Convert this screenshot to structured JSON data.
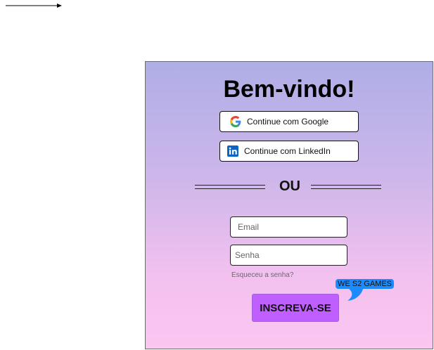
{
  "login": {
    "title": "Bem-vindo!",
    "google_label": "Continue com Google",
    "linkedin_label": "Continue com LinkedIn",
    "or_label": "OU",
    "email_placeholder": "Email",
    "password_placeholder": "Senha",
    "forgot_label": "Esqueceu a senha?",
    "submit_label": "INSCREVA-SE",
    "badge_label": "WE S2 GAMES"
  },
  "colors": {
    "panel_gradient_top": "#afaee6",
    "panel_gradient_bottom": "#fbc6f0",
    "submit_button": "#bf5fff",
    "badge": "#1a8cff",
    "linkedin_brand": "#0a66c2"
  },
  "icons": {
    "arrow": "arrow-right-icon",
    "google": "google-icon",
    "linkedin": "linkedin-icon"
  }
}
